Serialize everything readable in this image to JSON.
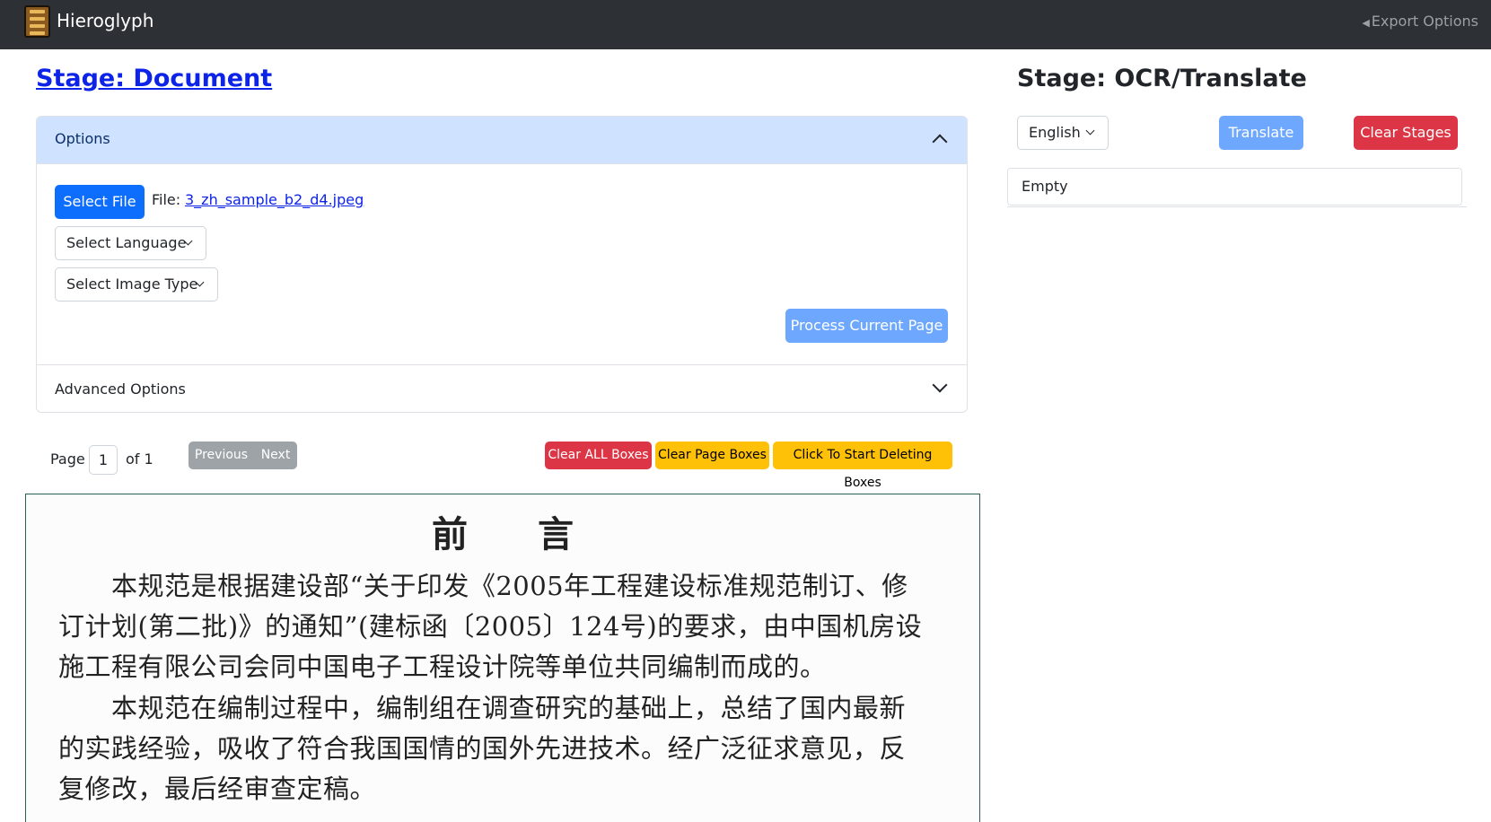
{
  "app": {
    "name": "Hieroglyph",
    "export_options": "Export Options"
  },
  "document_stage": {
    "title": "Stage: Document",
    "options_header": "Options",
    "select_file_label": "Select File",
    "file_label": "File:",
    "file_name": "3_zh_sample_b2_d4.jpeg",
    "select_language": "Select Language",
    "select_image_type": "Select Image Type",
    "process_current_page": "Process Current Page",
    "advanced_options": "Advanced Options"
  },
  "pagination": {
    "page_label": "Page",
    "current_page": "1",
    "of_label": "of 1",
    "previous": "Previous",
    "next": "Next"
  },
  "box_actions": {
    "clear_all": "Clear ALL Boxes",
    "clear_page": "Clear Page Boxes",
    "click_to_delete": "Click To Start Deleting Boxes"
  },
  "document_image": {
    "heading": "前言",
    "lines": [
      "　　本规范是根据建设部“关于印发《2005年工程建设标准规范制订、修",
      "订计划(第二批)》的通知”(建标函〔2005〕124号)的要求，由中国机房设",
      "施工程有限公司会同中国电子工程设计院等单位共同编制而成的。",
      "　　本规范在编制过程中，编制组在调查研究的基础上，总结了国内最新",
      "的实践经验，吸收了符合我国国情的国外先进技术。经广泛征求意见，反",
      "复修改，最后经审查定稿。"
    ]
  },
  "ocr_stage": {
    "title": "Stage: OCR/Translate",
    "language": "English",
    "translate": "Translate",
    "clear_stages": "Clear Stages",
    "empty_text": "Empty"
  },
  "colors": {
    "navbar": "#2d3034",
    "primary": "#0d6efd",
    "primary_disabled": "#6ea8fe",
    "danger": "#dc3545",
    "warning": "#ffc107",
    "secondary": "#9ea3a8",
    "accordion_active": "#cfe2ff"
  },
  "icons": [
    "logo-icon",
    "chevron-left-icon",
    "chevron-up-icon",
    "chevron-down-icon"
  ]
}
